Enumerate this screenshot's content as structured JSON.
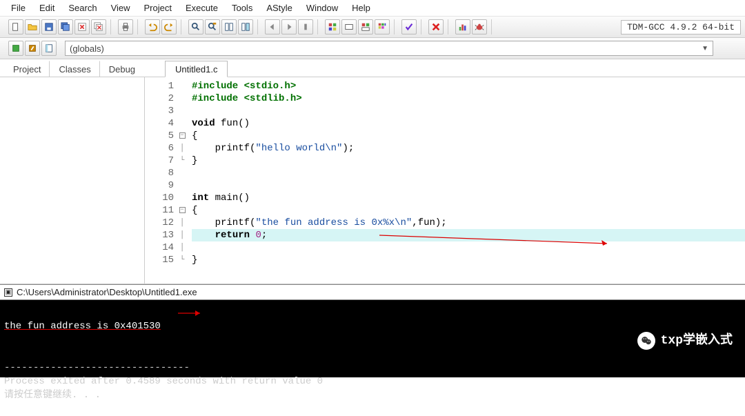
{
  "menu": [
    "File",
    "Edit",
    "Search",
    "View",
    "Project",
    "Execute",
    "Tools",
    "AStyle",
    "Window",
    "Help"
  ],
  "compiler": "TDM-GCC 4.9.2 64-bit",
  "globals_label": "(globals)",
  "side_tabs": [
    "Project",
    "Classes",
    "Debug"
  ],
  "file_tab": "Untitled1.c",
  "code": {
    "lines": [
      {
        "n": "1",
        "fold": "",
        "html": "<span class='pp'>#include</span> <span class='pp'>&lt;stdio.h&gt;</span>"
      },
      {
        "n": "2",
        "fold": "",
        "html": "<span class='pp'>#include</span> <span class='pp'>&lt;stdlib.h&gt;</span>"
      },
      {
        "n": "3",
        "fold": "",
        "html": ""
      },
      {
        "n": "4",
        "fold": "",
        "html": "<span class='kw'>void</span> <span class='fn'>fun</span>()"
      },
      {
        "n": "5",
        "fold": "[-]",
        "html": "{"
      },
      {
        "n": "6",
        "fold": "|",
        "html": "    printf(<span class='str'>\"hello world\\n\"</span>);"
      },
      {
        "n": "7",
        "fold": "L",
        "html": "}"
      },
      {
        "n": "8",
        "fold": "",
        "html": ""
      },
      {
        "n": "9",
        "fold": "",
        "html": ""
      },
      {
        "n": "10",
        "fold": "",
        "html": "<span class='kw'>int</span> <span class='fn'>main</span>()"
      },
      {
        "n": "11",
        "fold": "[-]",
        "html": "{"
      },
      {
        "n": "12",
        "fold": "|",
        "html": "    printf(<span class='str'>\"the fun address is 0x%x\\n\"</span>,fun);"
      },
      {
        "n": "13",
        "fold": "|",
        "html": "    <span class='kw'>return</span> <span class='num'>0</span>;",
        "hl": true
      },
      {
        "n": "14",
        "fold": "|",
        "html": ""
      },
      {
        "n": "15",
        "fold": "L",
        "html": "}"
      }
    ]
  },
  "console": {
    "path": "C:\\Users\\Administrator\\Desktop\\Untitled1.exe",
    "line1": "the fun address is 0x401530",
    "dashes": "--------------------------------",
    "line2": "Process exited after 0.4589 seconds with return value 0",
    "line3": "请按任意键继续. . ."
  },
  "watermark": "txp学嵌入式",
  "icons": {
    "new": "□",
    "open": "▭",
    "save": "💾",
    "saveall": "⧉",
    "close": "✕",
    "closeall": "✕",
    "print": "⎙",
    "undo": "↶",
    "redo": "↷",
    "find": "🔍",
    "replace": "🔎",
    "goto": "⇥",
    "bookmark": "★",
    "back": "◀",
    "fwd": "▶",
    "compile": "▦",
    "run": "▷",
    "compilerun": "▣",
    "rebuild": "▦",
    "check": "✔",
    "stop": "✖",
    "profile": "▥",
    "debug": "🐞"
  }
}
